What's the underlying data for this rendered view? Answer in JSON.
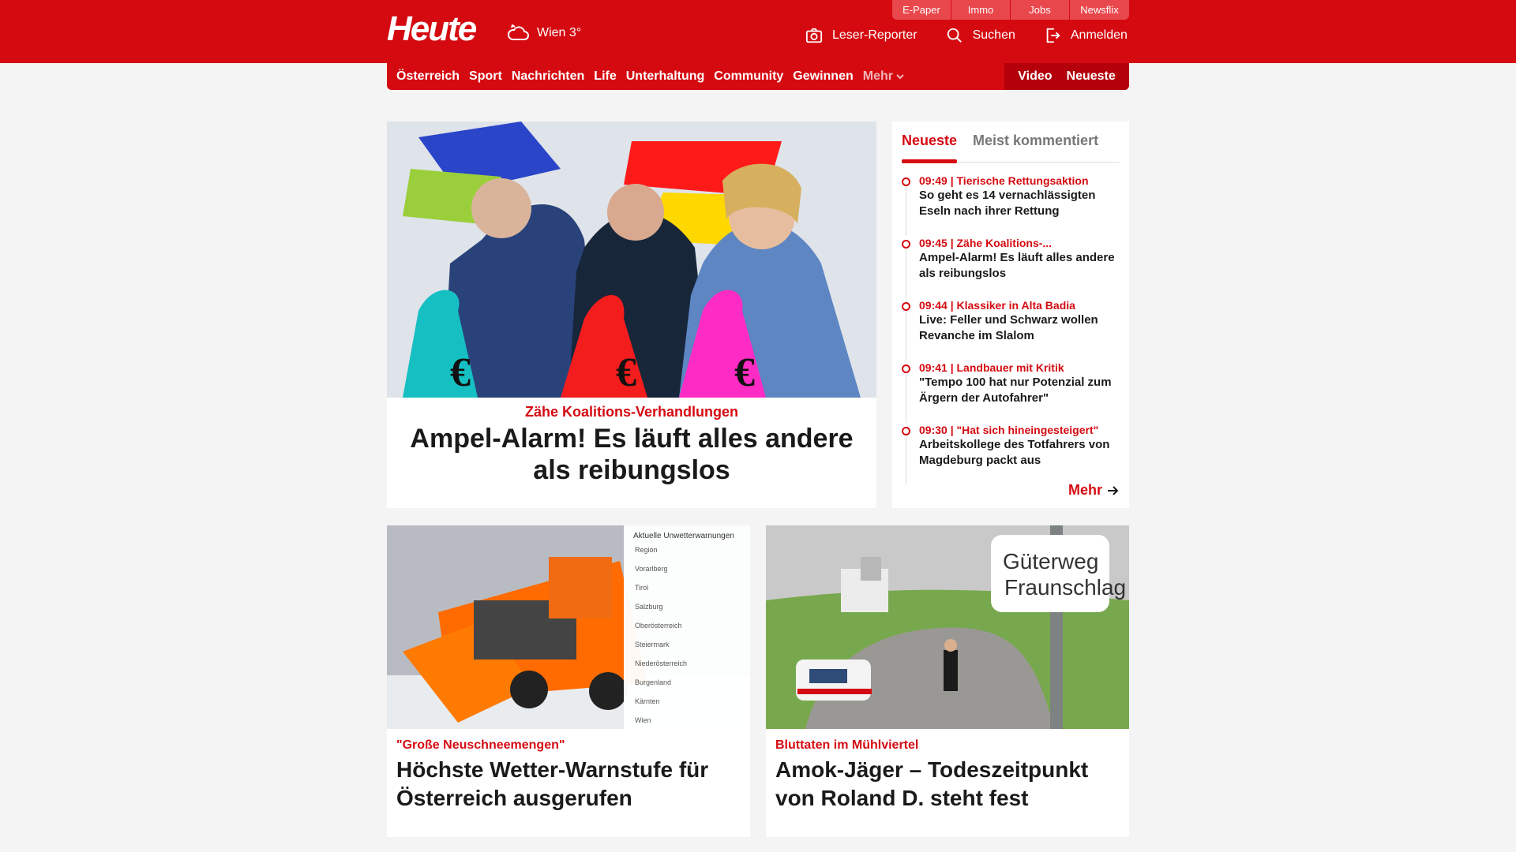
{
  "header": {
    "logo": "Heute",
    "weather_text": "Wien 3°",
    "utility_links": [
      "E-Paper",
      "Immo",
      "Jobs",
      "Newsflix"
    ],
    "actions": {
      "reporter": "Leser-Reporter",
      "search": "Suchen",
      "login": "Anmelden"
    }
  },
  "nav": {
    "items": [
      "Österreich",
      "Sport",
      "Nachrichten",
      "Life",
      "Unterhaltung",
      "Community",
      "Gewinnen"
    ],
    "more": "Mehr",
    "right": [
      "Video",
      "Neueste"
    ]
  },
  "hero": {
    "kicker": "Zähe Koalitions-Verhandlungen",
    "headline": "Ampel-Alarm! Es läuft alles andere als reibungslos"
  },
  "sidebar": {
    "tabs": [
      "Neueste",
      "Meist kommentiert"
    ],
    "items": [
      {
        "meta": "09:49 | Tierische Rettungsaktion",
        "title": "So geht es 14 vernachlässigten Eseln nach ihrer Rettung"
      },
      {
        "meta": "09:45 | Zähe Koalitions-...",
        "title": "Ampel-Alarm! Es läuft alles andere als reibungslos"
      },
      {
        "meta": "09:44 | Klassiker in Alta Badia",
        "title": "Live: Feller und Schwarz wollen Revanche im Slalom"
      },
      {
        "meta": "09:41 | Landbauer mit Kritik",
        "title": "\"Tempo 100 hat nur Potenzial zum Ärgern der Autofahrer\""
      },
      {
        "meta": "09:30 | \"Hat sich hineingesteigert\"",
        "title": "Arbeitskollege des Totfahrers von Magdeburg packt aus"
      }
    ],
    "more": "Mehr"
  },
  "cards": [
    {
      "kicker": "\"Große Neuschneemengen\"",
      "headline": "Höchste Wetter-Warnstufe für Österreich ausgerufen"
    },
    {
      "kicker": "Bluttaten im Mühlviertel",
      "headline": "Amok-Jäger – Todeszeitpunkt von Roland D. steht fest"
    }
  ],
  "images": {
    "warning_title": "Aktuelle Unwetterwarnungen",
    "warning_rows": [
      "Region",
      "Vorarlberg",
      "Tirol",
      "Salzburg",
      "Oberösterreich",
      "Steiermark",
      "Niederösterreich",
      "Burgenland",
      "Kärnten",
      "Wien"
    ],
    "sign_lines": [
      "Güterweg",
      "Fraunschlag"
    ]
  },
  "colors": {
    "brand": "#d50a11",
    "brand_dark": "#b3000b",
    "text": "#1a1a1a"
  }
}
